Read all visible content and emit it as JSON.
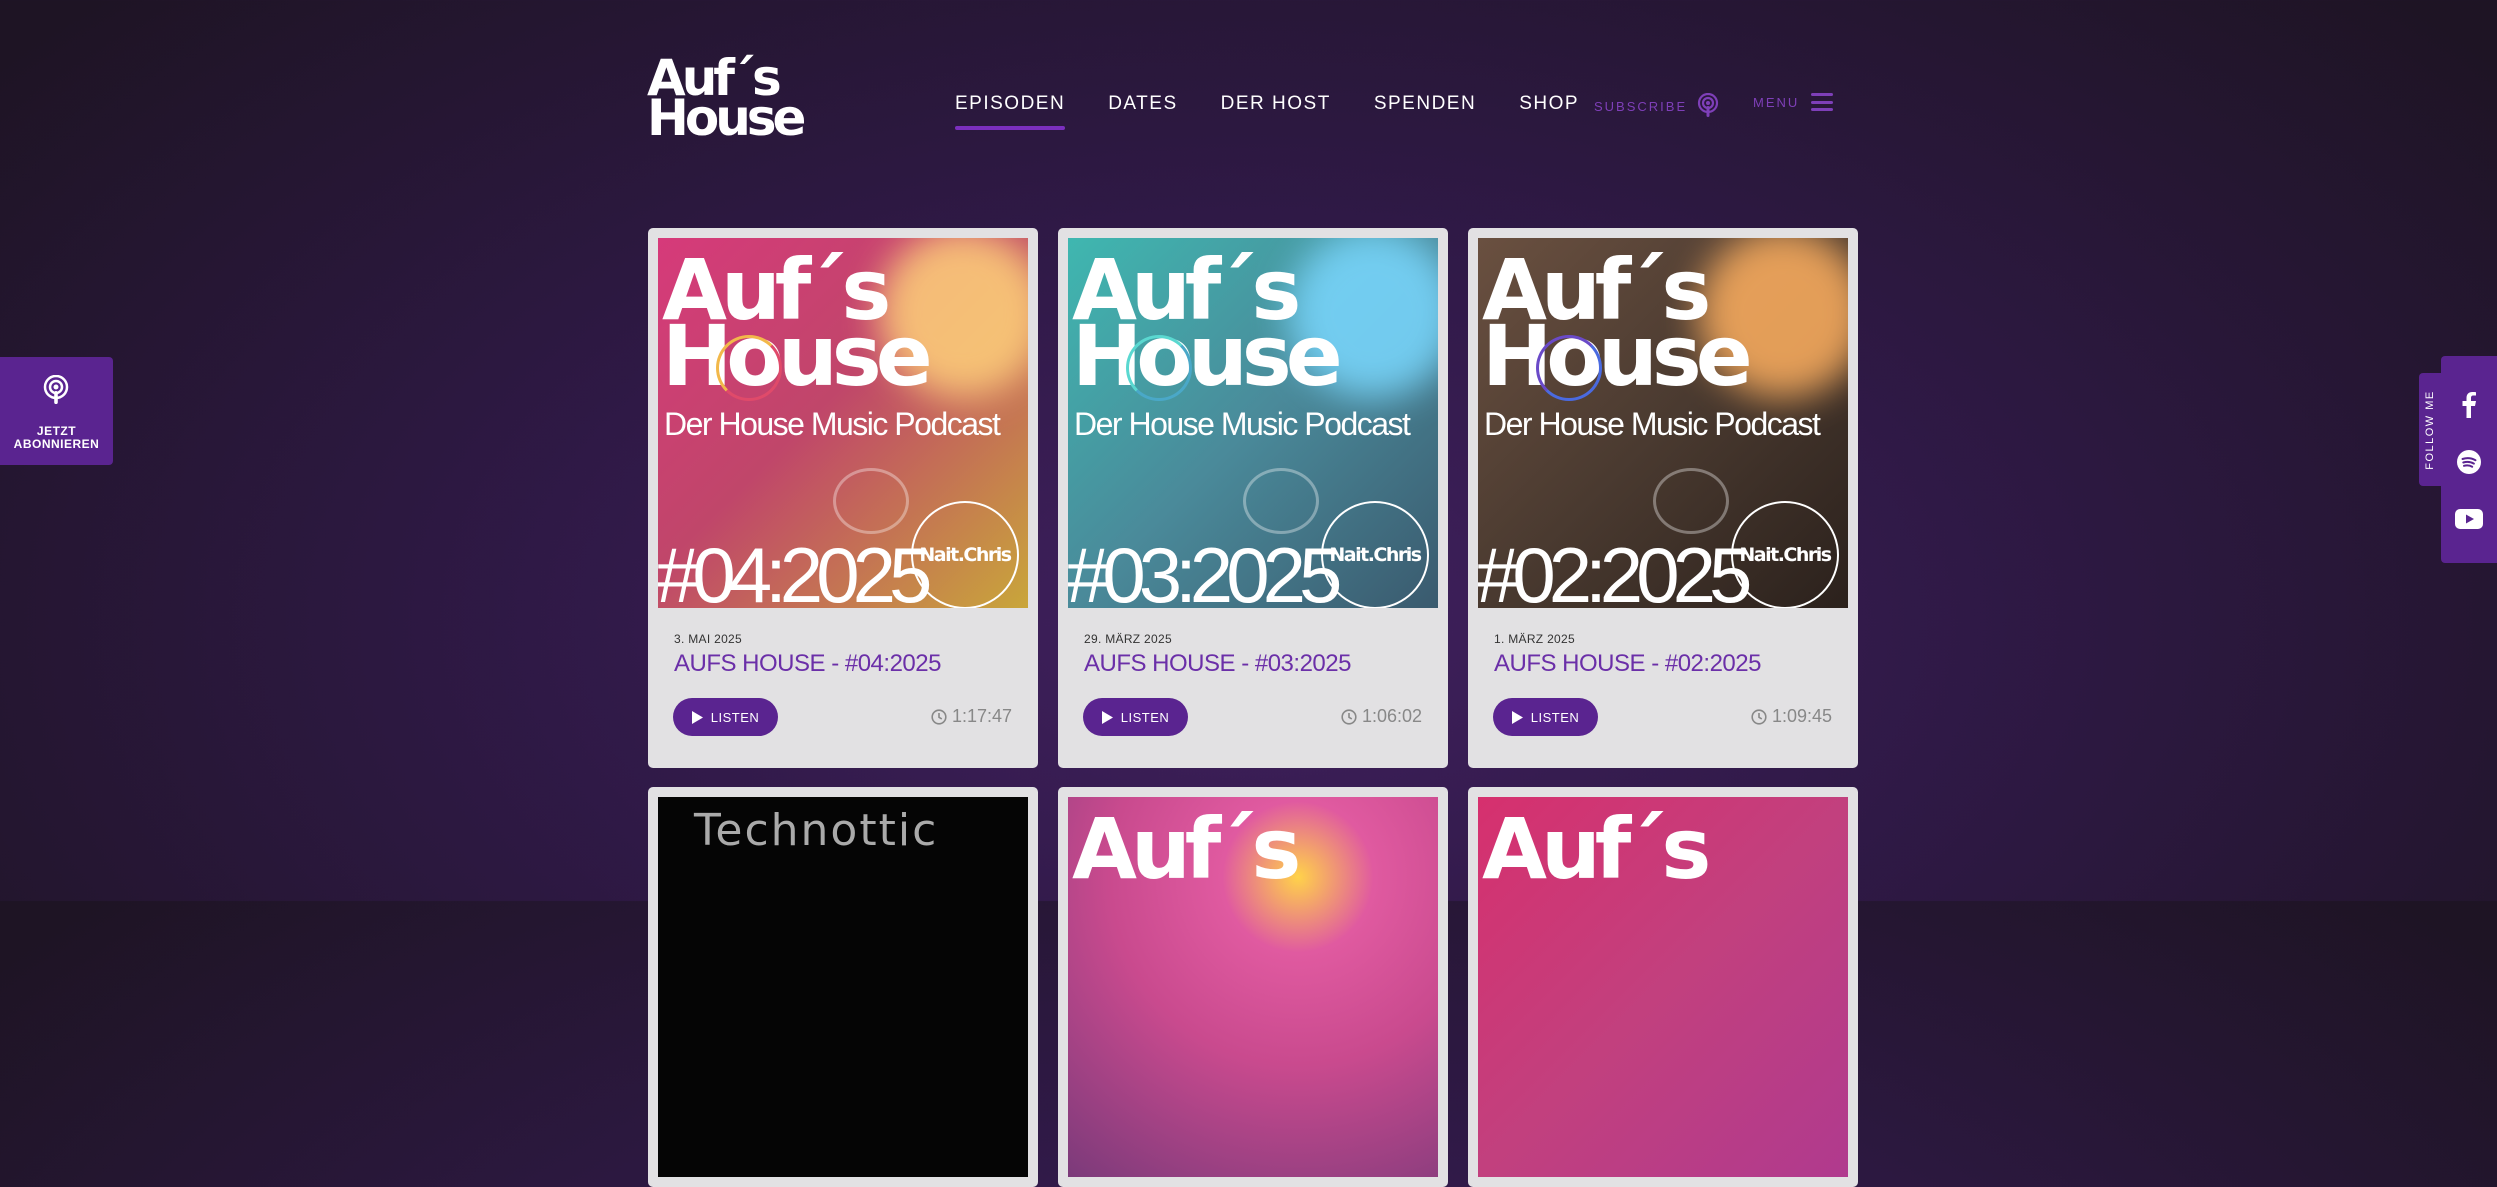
{
  "header": {
    "logo": {
      "line1": "Auf´s",
      "line2": "House"
    },
    "nav": [
      {
        "label": "EPISODEN",
        "active": true
      },
      {
        "label": "DATES",
        "active": false
      },
      {
        "label": "DER HOST",
        "active": false
      },
      {
        "label": "SPENDEN",
        "active": false
      },
      {
        "label": "SHOP",
        "active": false
      }
    ],
    "subscribe_label": "SUBSCRIBE",
    "menu_label": "MENU"
  },
  "side": {
    "subscribe_widget": {
      "line1": "JETZT",
      "line2": "ABONNIEREN"
    },
    "follow_label": "FOLLOW ME",
    "social": [
      "facebook-icon",
      "spotify-icon",
      "youtube-icon"
    ]
  },
  "episodes": [
    {
      "cover": {
        "title1": "Auf´s",
        "title2": "House",
        "subtitle": "Der House Music Podcast",
        "number": "#04:2025",
        "badge": "Nait.Chris"
      },
      "date": "3. MAI 2025",
      "title": "AUFS HOUSE - #04:2025",
      "listen_label": "LISTEN",
      "duration": "1:17:47",
      "colors": {
        "from": "#d63a7a",
        "to": "#c9a63a"
      }
    },
    {
      "cover": {
        "title1": "Auf´s",
        "title2": "House",
        "subtitle": "Der House Music Podcast",
        "number": "#03:2025",
        "badge": "Nait.Chris"
      },
      "date": "29. MÄRZ 2025",
      "title": "AUFS HOUSE - #03:2025",
      "listen_label": "LISTEN",
      "duration": "1:06:02",
      "colors": {
        "from": "#3fb7b0",
        "to": "#3a5a6e"
      }
    },
    {
      "cover": {
        "title1": "Auf´s",
        "title2": "House",
        "subtitle": "Der House Music Podcast",
        "number": "#02:2025",
        "badge": "Nait.Chris"
      },
      "date": "1. MÄRZ 2025",
      "title": "AUFS HOUSE - #02:2025",
      "listen_label": "LISTEN",
      "duration": "1:09:45",
      "colors": {
        "from": "#7a5a3e",
        "to": "#2b211c"
      }
    }
  ],
  "next_row": [
    {
      "cover_text": "Technottic"
    },
    {
      "cover_text": "Auf´s",
      "colors": {
        "from": "#c94a8e",
        "to": "#7b3a7a"
      }
    },
    {
      "cover_text": "Auf´s",
      "colors": {
        "from": "#d6306e",
        "to": "#b03a8e"
      }
    }
  ],
  "colors": {
    "accent": "#5a2490",
    "title": "#6b2fa8"
  }
}
